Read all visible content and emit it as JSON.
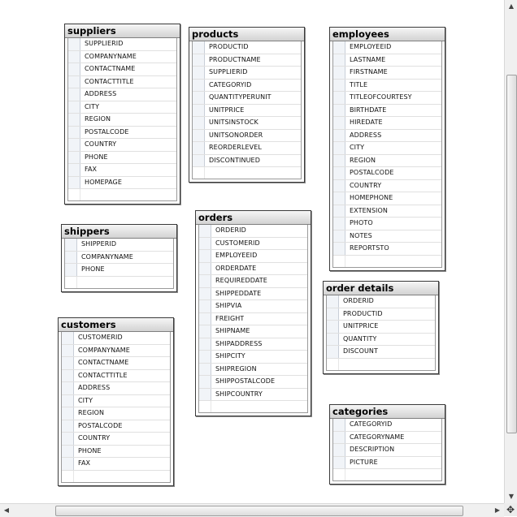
{
  "tables": [
    {
      "id": "suppliers",
      "title": "suppliers",
      "empty_rows": 1,
      "columns": [
        "SUPPLIERID",
        "COMPANYNAME",
        "CONTACTNAME",
        "CONTACTTITLE",
        "ADDRESS",
        "CITY",
        "REGION",
        "POSTALCODE",
        "COUNTRY",
        "PHONE",
        "FAX",
        "HOMEPAGE"
      ]
    },
    {
      "id": "products",
      "title": "products",
      "empty_rows": 1,
      "columns": [
        "PRODUCTID",
        "PRODUCTNAME",
        "SUPPLIERID",
        "CATEGORYID",
        "QUANTITYPERUNIT",
        "UNITPRICE",
        "UNITSINSTOCK",
        "UNITSONORDER",
        "REORDERLEVEL",
        "DISCONTINUED"
      ]
    },
    {
      "id": "employees",
      "title": "employees",
      "empty_rows": 1,
      "columns": [
        "EMPLOYEEID",
        "LASTNAME",
        "FIRSTNAME",
        "TITLE",
        "TITLEOFCOURTESY",
        "BIRTHDATE",
        "HIREDATE",
        "ADDRESS",
        "CITY",
        "REGION",
        "POSTALCODE",
        "COUNTRY",
        "HOMEPHONE",
        "EXTENSION",
        "PHOTO",
        "NOTES",
        "REPORTSTO"
      ]
    },
    {
      "id": "shippers",
      "title": "shippers",
      "empty_rows": 1,
      "columns": [
        "SHIPPERID",
        "COMPANYNAME",
        "PHONE"
      ]
    },
    {
      "id": "orders",
      "title": "orders",
      "empty_rows": 1,
      "columns": [
        "ORDERID",
        "CUSTOMERID",
        "EMPLOYEEID",
        "ORDERDATE",
        "REQUIREDDATE",
        "SHIPPEDDATE",
        "SHIPVIA",
        "FREIGHT",
        "SHIPNAME",
        "SHIPADDRESS",
        "SHIPCITY",
        "SHIPREGION",
        "SHIPPOSTALCODE",
        "SHIPCOUNTRY"
      ]
    },
    {
      "id": "order_details",
      "title": "order details",
      "empty_rows": 1,
      "columns": [
        "ORDERID",
        "PRODUCTID",
        "UNITPRICE",
        "QUANTITY",
        "DISCOUNT"
      ]
    },
    {
      "id": "customers",
      "title": "customers",
      "empty_rows": 1,
      "columns": [
        "CUSTOMERID",
        "COMPANYNAME",
        "CONTACTNAME",
        "CONTACTTITLE",
        "ADDRESS",
        "CITY",
        "REGION",
        "POSTALCODE",
        "COUNTRY",
        "PHONE",
        "FAX"
      ]
    },
    {
      "id": "categories",
      "title": "categories",
      "empty_rows": 1,
      "columns": [
        "CATEGORYID",
        "CATEGORYNAME",
        "DESCRIPTION",
        "PICTURE"
      ]
    }
  ],
  "scrollbars": {
    "up_icon": "arrow-up-icon",
    "down_icon": "arrow-down-icon",
    "left_icon": "arrow-left-icon",
    "right_icon": "arrow-right-icon",
    "corner_icon": "move-icon"
  }
}
